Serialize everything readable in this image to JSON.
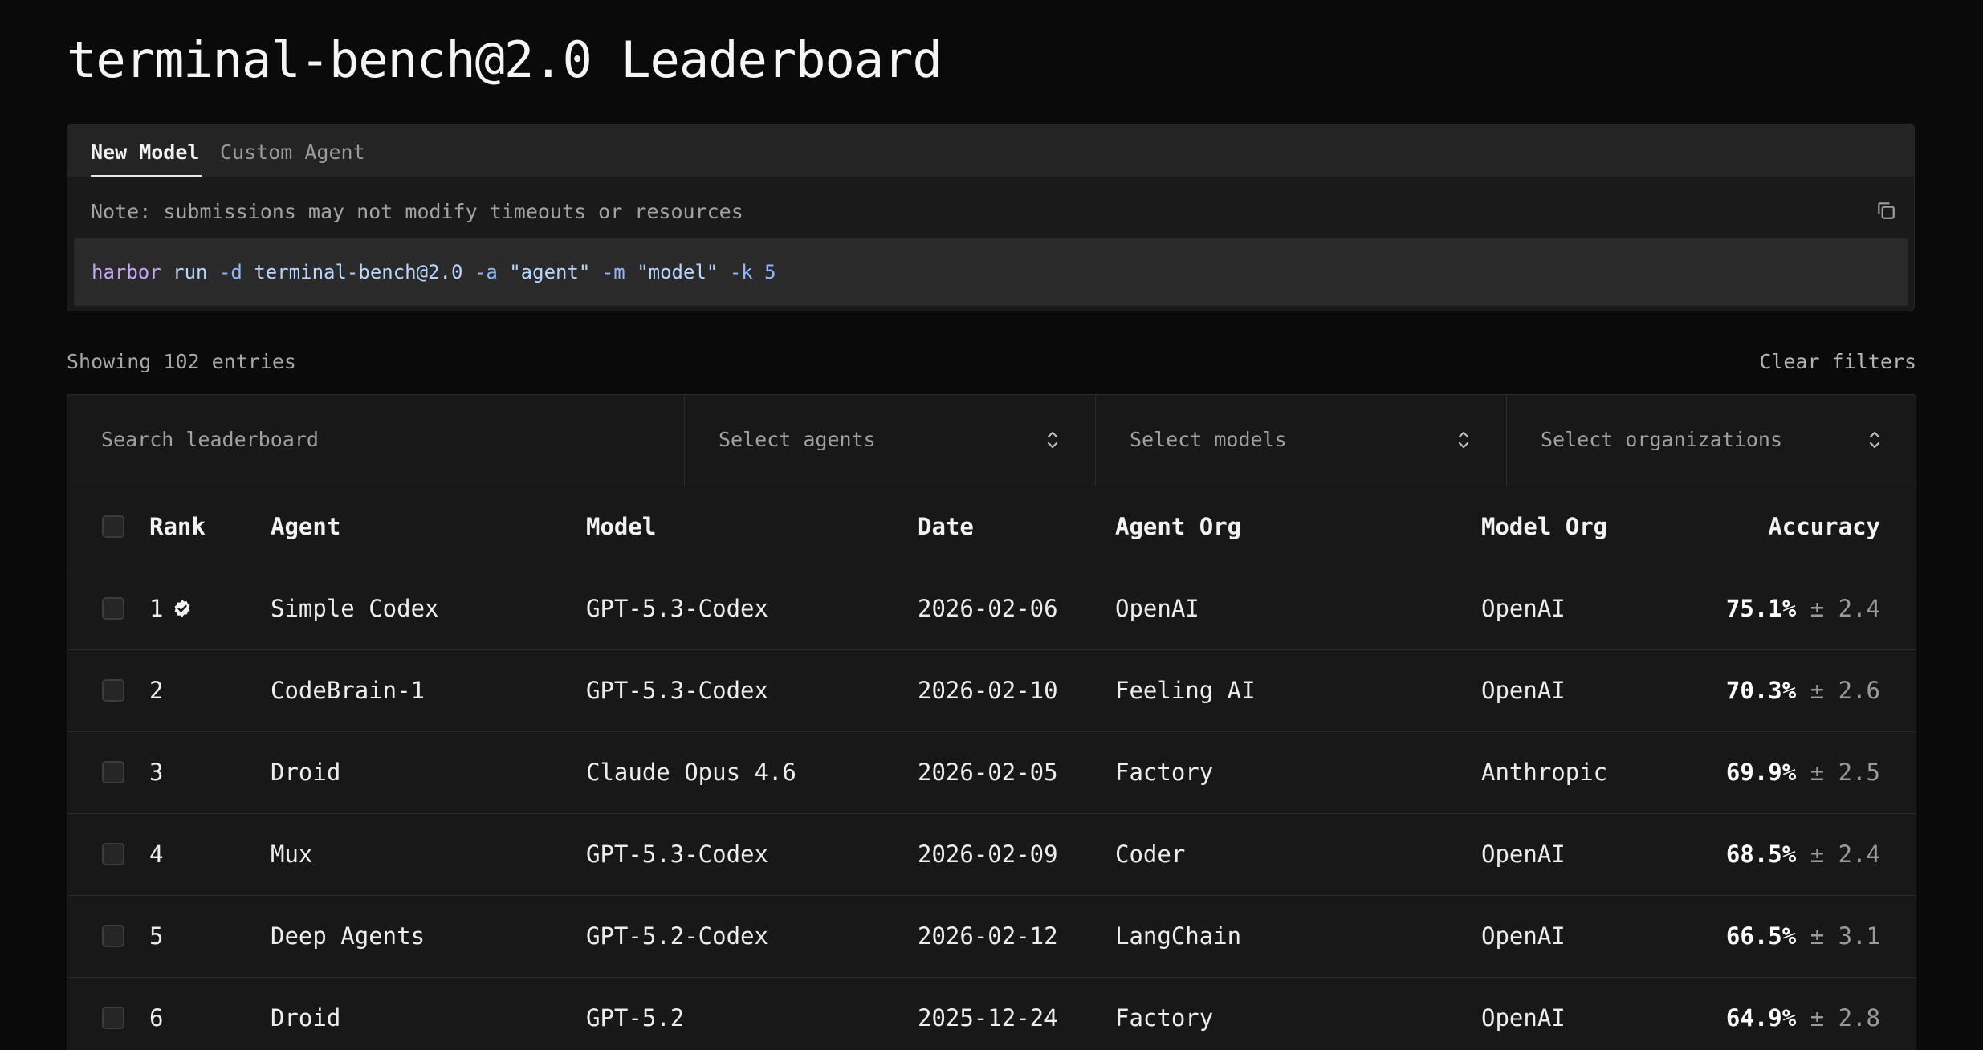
{
  "page": {
    "title": "terminal-bench@2.0 Leaderboard"
  },
  "submission": {
    "tabs": [
      {
        "label": "New Model",
        "active": true
      },
      {
        "label": "Custom Agent",
        "active": false
      }
    ],
    "note": "Note: submissions may not modify timeouts or resources",
    "command": {
      "cmd": "harbor",
      "sub": "run",
      "flag_d": "-d",
      "dataset": "terminal-bench@2.0",
      "flag_a": "-a",
      "agent": "\"agent\"",
      "flag_m": "-m",
      "model": "\"model\"",
      "flag_k": "-k",
      "k": "5"
    },
    "copy_icon": "copy-icon"
  },
  "summary": {
    "showing": "Showing 102 entries",
    "clear_filters": "Clear filters"
  },
  "filters": {
    "search_placeholder": "Search leaderboard",
    "agents": "Select agents",
    "models": "Select models",
    "organizations": "Select organizations"
  },
  "table": {
    "headers": {
      "rank": "Rank",
      "agent": "Agent",
      "model": "Model",
      "date": "Date",
      "agent_org": "Agent Org",
      "model_org": "Model Org",
      "accuracy": "Accuracy"
    },
    "rows": [
      {
        "rank": "1",
        "verified": true,
        "agent": "Simple Codex",
        "model": "GPT-5.3-Codex",
        "date": "2026-02-06",
        "agent_org": "OpenAI",
        "model_org": "OpenAI",
        "accuracy": "75.1%",
        "error": "± 2.4"
      },
      {
        "rank": "2",
        "verified": false,
        "agent": "CodeBrain-1",
        "model": "GPT-5.3-Codex",
        "date": "2026-02-10",
        "agent_org": "Feeling AI",
        "model_org": "OpenAI",
        "accuracy": "70.3%",
        "error": "± 2.6"
      },
      {
        "rank": "3",
        "verified": false,
        "agent": "Droid",
        "model": "Claude Opus 4.6",
        "date": "2026-02-05",
        "agent_org": "Factory",
        "model_org": "Anthropic",
        "accuracy": "69.9%",
        "error": "± 2.5"
      },
      {
        "rank": "4",
        "verified": false,
        "agent": "Mux",
        "model": "GPT-5.3-Codex",
        "date": "2026-02-09",
        "agent_org": "Coder",
        "model_org": "OpenAI",
        "accuracy": "68.5%",
        "error": "± 2.4"
      },
      {
        "rank": "5",
        "verified": false,
        "agent": "Deep Agents",
        "model": "GPT-5.2-Codex",
        "date": "2026-02-12",
        "agent_org": "LangChain",
        "model_org": "OpenAI",
        "accuracy": "66.5%",
        "error": "± 3.1"
      },
      {
        "rank": "6",
        "verified": false,
        "agent": "Droid",
        "model": "GPT-5.2",
        "date": "2025-12-24",
        "agent_org": "Factory",
        "model_org": "OpenAI",
        "accuracy": "64.9%",
        "error": "± 2.8"
      }
    ]
  }
}
